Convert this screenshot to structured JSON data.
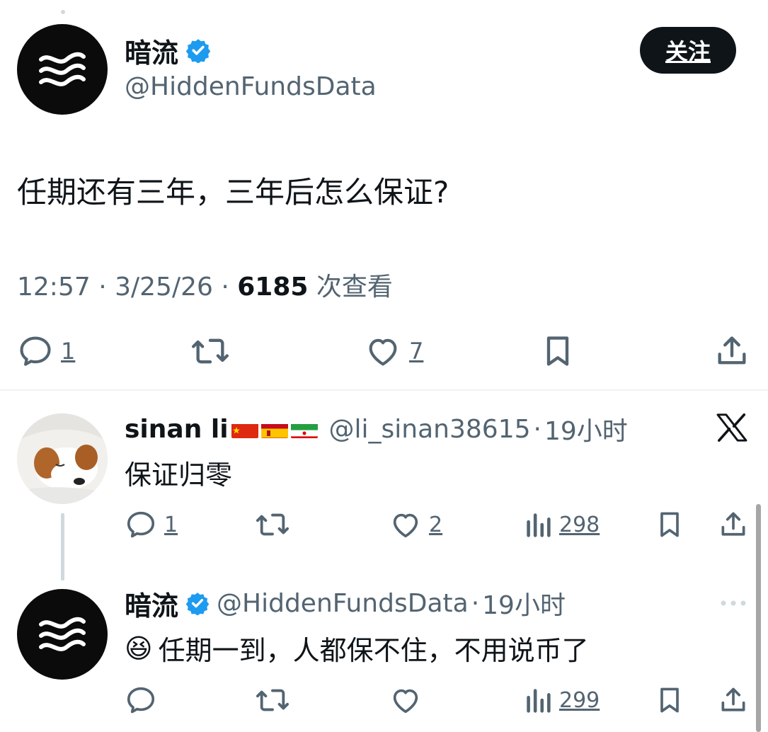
{
  "colors": {
    "text": "#0f1419",
    "muted": "#536471",
    "verified": "#1d9bf0",
    "button_bg": "#0f1419"
  },
  "main_tweet": {
    "display_name": "暗流",
    "handle": "@HiddenFundsData",
    "follow_label": "关注",
    "text": "任期还有三年，三年后怎么保证?",
    "time": "12:57",
    "dot1": "·",
    "date": "3/25/26",
    "dot2": "·",
    "views_count": "6185",
    "views_label": "次查看",
    "actions": {
      "replies": "1",
      "likes": "7"
    }
  },
  "reply1": {
    "display_name": "sinan li",
    "flags": [
      "china-flag",
      "spain-flag",
      "iran-flag"
    ],
    "handle": "@li_sinan38615",
    "dot": "·",
    "time": "19小时",
    "text": "保证归零",
    "actions": {
      "replies": "1",
      "likes": "2",
      "views": "298"
    }
  },
  "reply2": {
    "display_name": "暗流",
    "handle": "@HiddenFundsData",
    "dot": "·",
    "time": "19小时",
    "emoji": "😆",
    "text": "任期一到，人都保不住，不用说币了",
    "actions": {
      "views": "299"
    }
  }
}
